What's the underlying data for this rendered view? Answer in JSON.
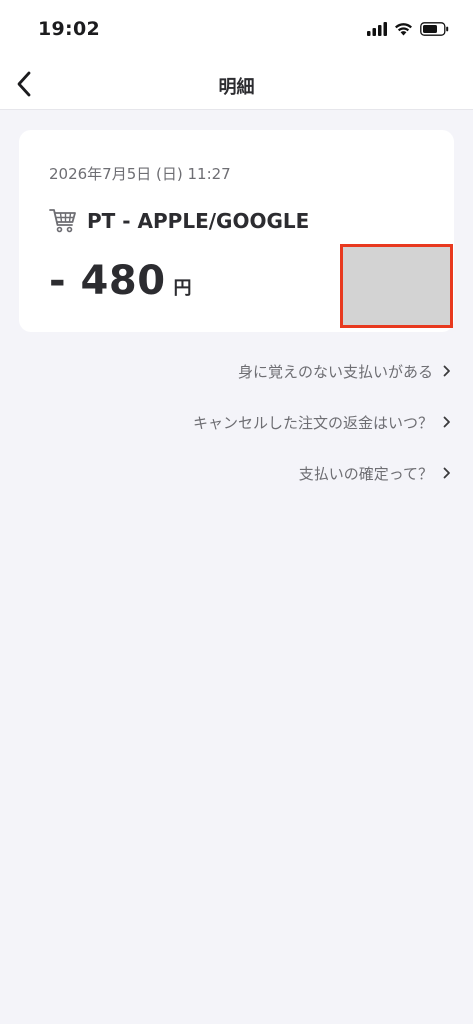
{
  "status_bar": {
    "time": "19:02"
  },
  "nav": {
    "title": "明細"
  },
  "transaction": {
    "date": "2026年7月5日 (日) 11:27",
    "merchant_icon": "cart-icon",
    "merchant": "PT - APPLE/GOOGLE",
    "amount": "- 480",
    "unit": "円"
  },
  "help_links": [
    {
      "label": "身に覚えのない支払いがある"
    },
    {
      "label": "キャンセルした注文の返金はいつ？"
    },
    {
      "label": "支払いの確定って？"
    }
  ],
  "colors": {
    "background": "#f4f4f9",
    "card": "#ffffff",
    "text": "#2c2c30",
    "muted": "#6e6e73",
    "redaction_border": "#e8391f",
    "redaction_fill": "#d3d3d3"
  }
}
